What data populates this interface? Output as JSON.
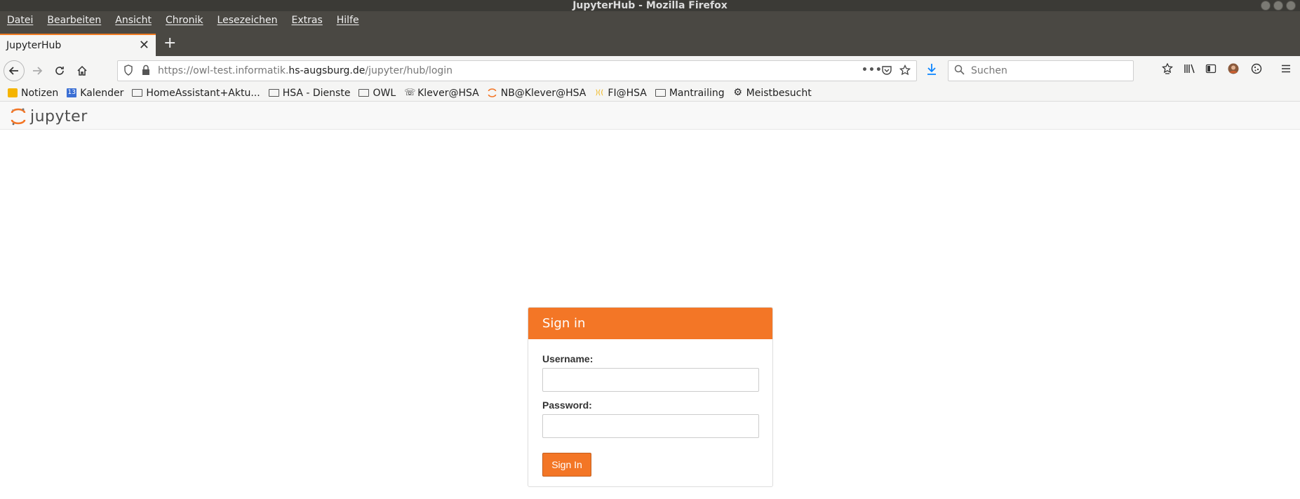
{
  "window": {
    "title": "JupyterHub - Mozilla Firefox"
  },
  "menubar": {
    "items": [
      "Datei",
      "Bearbeiten",
      "Ansicht",
      "Chronik",
      "Lesezeichen",
      "Extras",
      "Hilfe"
    ]
  },
  "tabs": [
    {
      "label": "JupyterHub"
    }
  ],
  "navbar": {
    "url_prefix": "https://owl-test.informatik.",
    "url_domain": "hs-augsburg.de",
    "url_path": "/jupyter/hub/login",
    "search_placeholder": "Suchen"
  },
  "bookmarks": [
    {
      "label": "Notizen",
      "icon": "notes-icon"
    },
    {
      "label": "Kalender",
      "icon": "calendar-icon"
    },
    {
      "label": "HomeAssistant+Aktu...",
      "icon": "folder-icon"
    },
    {
      "label": "HSA - Dienste",
      "icon": "folder-icon"
    },
    {
      "label": "OWL",
      "icon": "folder-icon"
    },
    {
      "label": "Klever@HSA",
      "icon": "phone-icon"
    },
    {
      "label": "NB@Klever@HSA",
      "icon": "jupyter-icon"
    },
    {
      "label": "FI@HSA",
      "icon": "site-icon"
    },
    {
      "label": "Mantrailing",
      "icon": "folder-icon"
    },
    {
      "label": "Meistbesucht",
      "icon": "gear-icon"
    }
  ],
  "jupyter": {
    "logo_text": "jupyter"
  },
  "login": {
    "header": "Sign in",
    "username_label": "Username:",
    "password_label": "Password:",
    "submit_label": "Sign In",
    "username_value": "",
    "password_value": ""
  },
  "colors": {
    "accent": "#f37626",
    "menubar_bg": "#4a4843",
    "toolbar_bg": "#f5f5f4"
  }
}
